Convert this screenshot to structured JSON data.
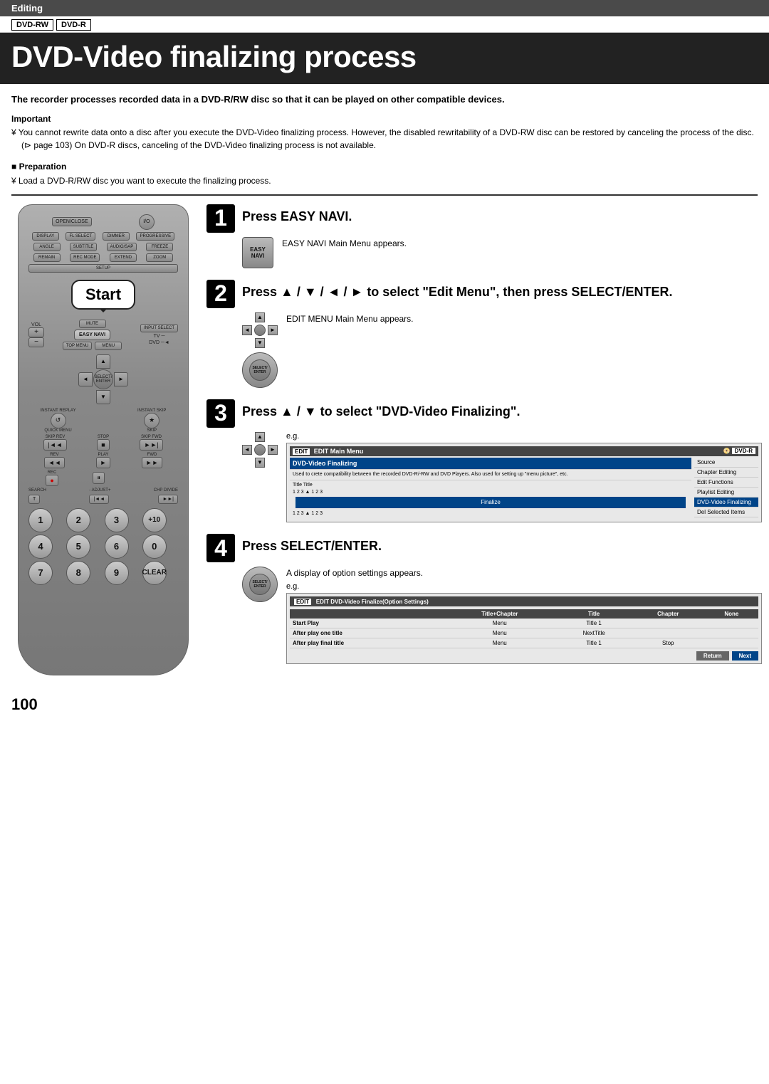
{
  "header": {
    "section": "Editing",
    "badges": [
      "DVD-RW",
      "DVD-R"
    ],
    "title": "DVD-Video finalizing process"
  },
  "intro": {
    "bold_text": "The recorder processes recorded data in a DVD-R/RW disc so that it can be played on other compatible devices.",
    "important_label": "Important",
    "important_text": "¥ You cannot rewrite data onto a disc after you execute the DVD-Video finalizing process. However, the disabled rewritability of a DVD-RW disc can be restored by canceling the process of the disc. (⊳ page 103) On DVD-R discs, canceling of the DVD-Video finalizing process is not available.",
    "preparation_label": "Preparation",
    "preparation_text": "¥ Load a DVD-R/RW disc you want to execute the finalizing process."
  },
  "remote": {
    "start_label": "Start",
    "top_menu_label": "TOP MENU",
    "easy_navi_label": "EASY NAVI",
    "menu_label": "MENU",
    "select_enter_label": "SELECT/ ENTER",
    "mute_label": "MUTE",
    "input_select_label": "INPUT SELECT",
    "vol_up": "+",
    "vol_down": "−",
    "buttons": {
      "display": "DISPLAY",
      "fl_select": "FL SELECT",
      "dimmer": "DIMMER",
      "progressive": "PROGRESSIVE",
      "angle": "ANGLE",
      "subtitle": "SUBTITLE",
      "audio_sap": "AUDIO/SAP",
      "freeze": "FREEZE",
      "remain": "REMAIN",
      "rec_mode": "REC MODE",
      "extend": "EXTEND",
      "zoom": "ZOOM",
      "setup": "SETUP",
      "open_close": "OPEN/CLOSE",
      "power": "I/O",
      "skip_rev": "SKIP REV",
      "stop": "STOP",
      "skip_fwd": "SKIP FWD",
      "rev": "REV",
      "play": "PLAY",
      "fwd": "FWD",
      "rec": "REC",
      "pause": "II",
      "search": "SEARCH",
      "adjust": "- ADJUST+",
      "chp_divide": "CHP DIVIDE",
      "instant_replay": "INSTANT REPLAY",
      "quick_menu": "QUICK MENU",
      "instant_skip": "INSTANT SKIP",
      "t": "T",
      "nav1": "I◄◄",
      "nav2": "►►I",
      "clear": "CLEAR"
    },
    "numbers": [
      "1",
      "2",
      "3",
      "+10",
      "4",
      "5",
      "6",
      "0",
      "7",
      "8",
      "9",
      "CLEAR"
    ],
    "tv_dvd": [
      "TV",
      "DVD"
    ]
  },
  "steps": [
    {
      "number": "1",
      "title": "Press EASY NAVI.",
      "description": "EASY NAVI Main Menu appears.",
      "eg": null,
      "button_label": "EASY\nNAVI"
    },
    {
      "number": "2",
      "title": "Press ▲ / ▼ / ◄ / ► to select \"Edit Menu\", then press SELECT/ENTER.",
      "description": "EDIT MENU Main Menu appears.",
      "eg": null,
      "button_label": "SELECT/\nENTER"
    },
    {
      "number": "3",
      "title": "Press ▲ / ▼ to select \"DVD-Video Finalizing\".",
      "description": "e.g.",
      "screen": {
        "header_left": "EDIT Main Menu",
        "header_right": "DVD-R",
        "main_item": "DVD-Video Finalizing",
        "main_desc": "Used to crete compatibility between the recorded DVD-R/-RW and DVD Players. Also used for setting up \"menu picture\", etc.",
        "title_row": "Title   Title",
        "title_items": "1  2  3  ▲  1  2  3",
        "finalize": "Finalize",
        "menu_items": [
          "Source",
          "Chapter Editing",
          "Edit Functions",
          "Playlist Editing",
          "DVD-Video Finalizing",
          "Del Selected Items"
        ]
      }
    },
    {
      "number": "4",
      "title": "Press SELECT/ENTER.",
      "description": "A display of option settings appears.",
      "eg": "e.g.",
      "screen2": {
        "header": "EDIT  DVD-Video Finalize(Option Settings)",
        "columns": [
          "Title+Chapter",
          "Title",
          "Chapter",
          "None"
        ],
        "rows": [
          {
            "label": "Start Play",
            "col1": "Menu",
            "col2": "Title 1",
            "col3": "",
            "col4": ""
          },
          {
            "label": "After play one title",
            "col1": "Menu",
            "col2": "NextTitle",
            "col3": "",
            "col4": ""
          },
          {
            "label": "After play final title",
            "col1": "Menu",
            "col2": "Title 1",
            "col3": "Stop",
            "col4": ""
          }
        ],
        "btn_return": "Return",
        "btn_next": "Next"
      }
    }
  ],
  "page_number": "100"
}
